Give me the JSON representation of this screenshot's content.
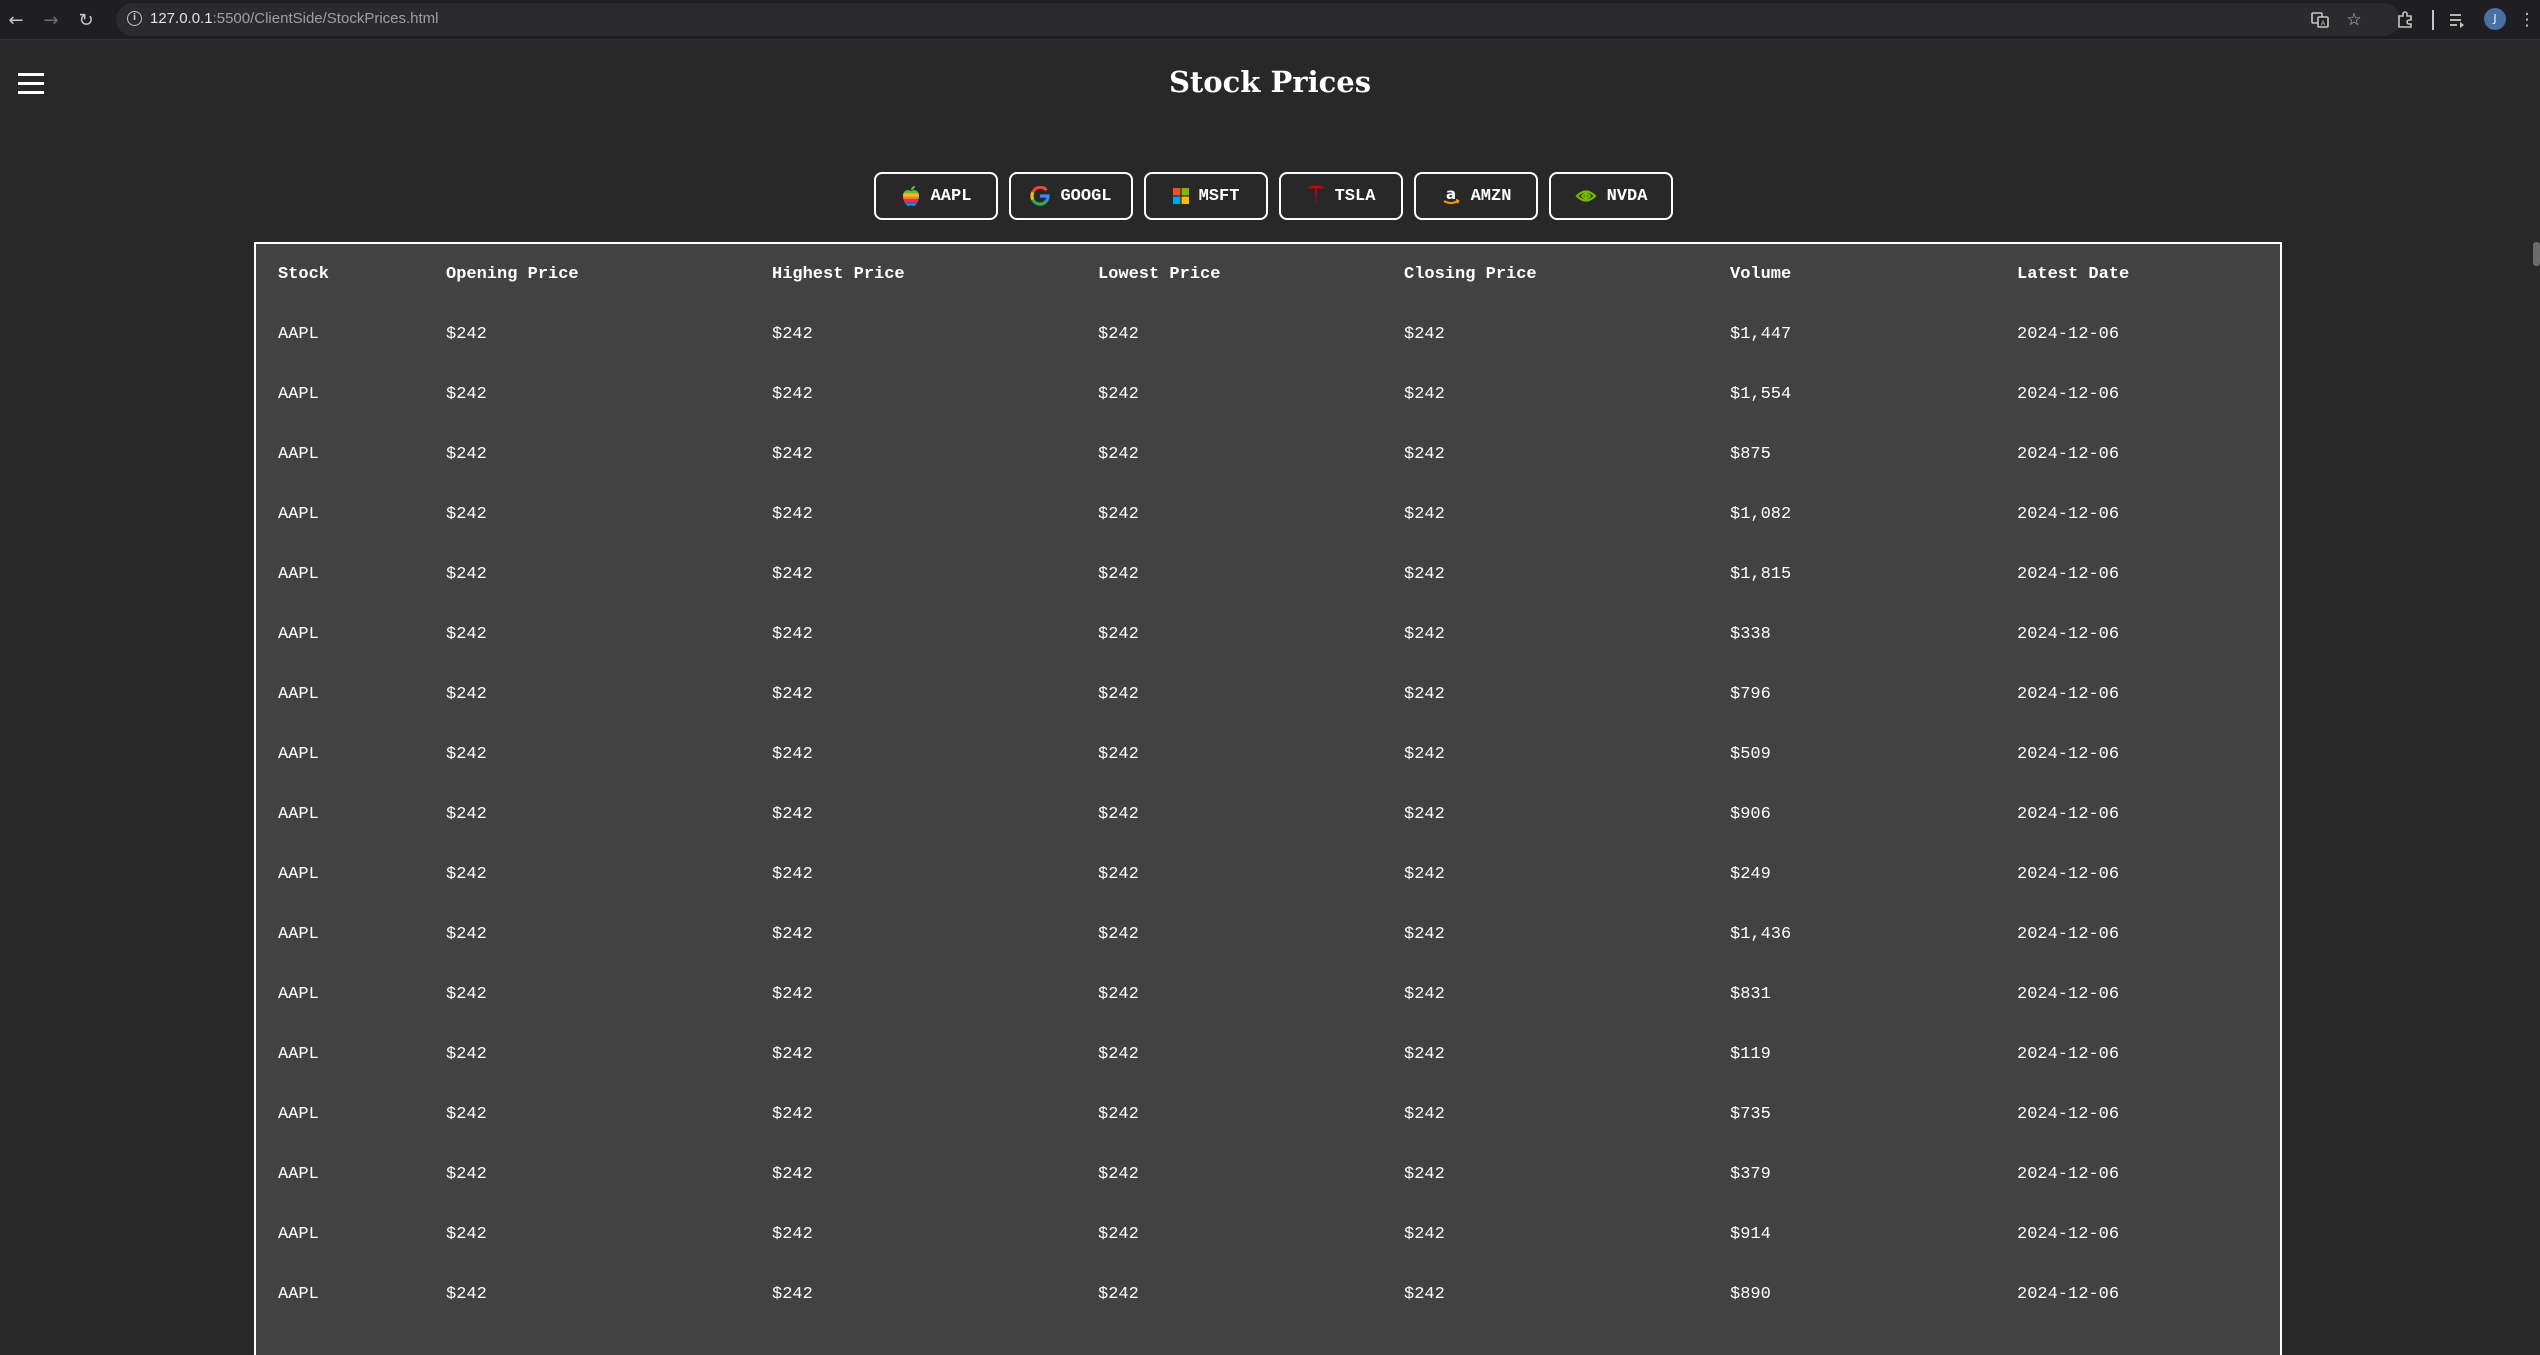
{
  "browser": {
    "url_host": "127.0.0.1",
    "url_rest": ":5500/ClientSide/StockPrices.html",
    "profile_initial": "J"
  },
  "page": {
    "title": "Stock Prices"
  },
  "tickers": [
    {
      "symbol": "AAPL",
      "icon": "apple-logo-icon"
    },
    {
      "symbol": "GOOGL",
      "icon": "google-logo-icon"
    },
    {
      "symbol": "MSFT",
      "icon": "microsoft-logo-icon"
    },
    {
      "symbol": "TSLA",
      "icon": "tesla-logo-icon"
    },
    {
      "symbol": "AMZN",
      "icon": "amazon-logo-icon"
    },
    {
      "symbol": "NVDA",
      "icon": "nvidia-logo-icon"
    }
  ],
  "table": {
    "headers": [
      "Stock",
      "Opening Price",
      "Highest Price",
      "Lowest Price",
      "Closing Price",
      "Volume",
      "Latest Date"
    ],
    "rows": [
      [
        "AAPL",
        "$242",
        "$242",
        "$242",
        "$242",
        "$1,447",
        "2024-12-06"
      ],
      [
        "AAPL",
        "$242",
        "$242",
        "$242",
        "$242",
        "$1,554",
        "2024-12-06"
      ],
      [
        "AAPL",
        "$242",
        "$242",
        "$242",
        "$242",
        "$875",
        "2024-12-06"
      ],
      [
        "AAPL",
        "$242",
        "$242",
        "$242",
        "$242",
        "$1,082",
        "2024-12-06"
      ],
      [
        "AAPL",
        "$242",
        "$242",
        "$242",
        "$242",
        "$1,815",
        "2024-12-06"
      ],
      [
        "AAPL",
        "$242",
        "$242",
        "$242",
        "$242",
        "$338",
        "2024-12-06"
      ],
      [
        "AAPL",
        "$242",
        "$242",
        "$242",
        "$242",
        "$796",
        "2024-12-06"
      ],
      [
        "AAPL",
        "$242",
        "$242",
        "$242",
        "$242",
        "$509",
        "2024-12-06"
      ],
      [
        "AAPL",
        "$242",
        "$242",
        "$242",
        "$242",
        "$906",
        "2024-12-06"
      ],
      [
        "AAPL",
        "$242",
        "$242",
        "$242",
        "$242",
        "$249",
        "2024-12-06"
      ],
      [
        "AAPL",
        "$242",
        "$242",
        "$242",
        "$242",
        "$1,436",
        "2024-12-06"
      ],
      [
        "AAPL",
        "$242",
        "$242",
        "$242",
        "$242",
        "$831",
        "2024-12-06"
      ],
      [
        "AAPL",
        "$242",
        "$242",
        "$242",
        "$242",
        "$119",
        "2024-12-06"
      ],
      [
        "AAPL",
        "$242",
        "$242",
        "$242",
        "$242",
        "$735",
        "2024-12-06"
      ],
      [
        "AAPL",
        "$242",
        "$242",
        "$242",
        "$242",
        "$379",
        "2024-12-06"
      ],
      [
        "AAPL",
        "$242",
        "$242",
        "$242",
        "$242",
        "$914",
        "2024-12-06"
      ],
      [
        "AAPL",
        "$242",
        "$242",
        "$242",
        "$242",
        "$890",
        "2024-12-06"
      ]
    ]
  },
  "colors": {
    "page_background": "#282829",
    "table_background": "#424242",
    "text": "#ffffff",
    "browser_chrome": "#1f1f21"
  }
}
